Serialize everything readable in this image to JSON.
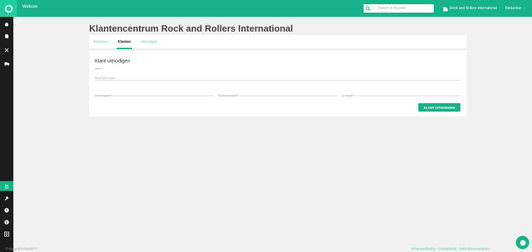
{
  "topbar": {
    "welcome": "Welkom",
    "search_placeholder": "Zoeken in Rayden",
    "organization": "Rock and Rollers International",
    "user": "Redacteur"
  },
  "sidebar": {
    "top_icons": [
      "home-icon",
      "document-icon",
      "tools-icon",
      "truck-icon"
    ],
    "bottom_icons": [
      "users-icon",
      "wrench-icon",
      "help-icon",
      "info-icon",
      "grid-icon"
    ],
    "active": "users-icon"
  },
  "page": {
    "title": "Klantencentrum Rock and Rollers International"
  },
  "tabs": [
    {
      "label": "Bedrijven",
      "active": false
    },
    {
      "label": "Klanten",
      "active": true
    },
    {
      "label": "Uitnodigen",
      "active": false
    }
  ],
  "form": {
    "title": "Klant uitnodigen",
    "name_label": "Naam*",
    "name_placeholder": "Bedrijfsnaam",
    "firstname_placeholder": "Voornaam*",
    "lastname_placeholder": "Achternaam*",
    "email_placeholder": "E-mail*",
    "submit_label": "KLANT UITNODIGEN"
  },
  "footer": {
    "copyright": "© Copyright Rayden™",
    "links": "Privacyverklaring · Cookiebeleid · Gebruiksvoorwaarden"
  },
  "colors": {
    "accent": "#17b38a",
    "sidebar": "#1c1c1c",
    "background": "#f1f1f1"
  }
}
